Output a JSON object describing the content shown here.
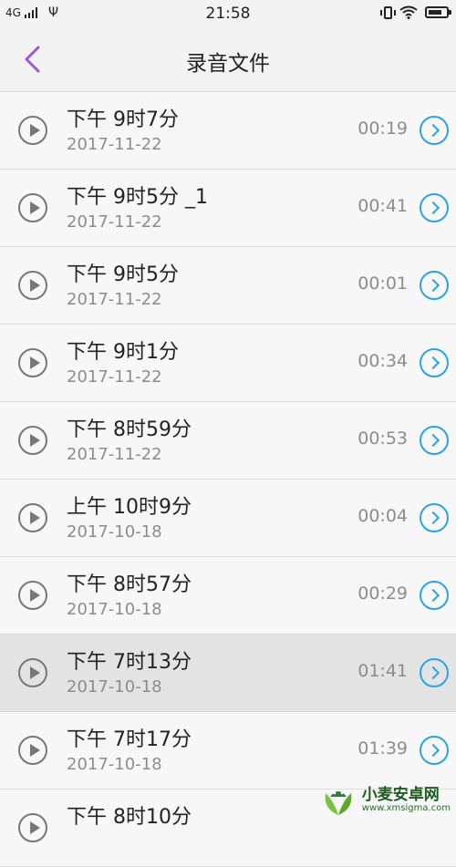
{
  "status_bar": {
    "network": "4G",
    "time": "21:58"
  },
  "header": {
    "title": "录音文件"
  },
  "recordings": [
    {
      "name": "下午 9时7分",
      "date": "2017-11-22",
      "duration": "00:19"
    },
    {
      "name": "下午 9时5分 _1",
      "date": "2017-11-22",
      "duration": "00:41"
    },
    {
      "name": "下午 9时5分",
      "date": "2017-11-22",
      "duration": "00:01"
    },
    {
      "name": "下午 9时1分",
      "date": "2017-11-22",
      "duration": "00:34"
    },
    {
      "name": "下午 8时59分",
      "date": "2017-11-22",
      "duration": "00:53"
    },
    {
      "name": "上午 10时9分",
      "date": "2017-10-18",
      "duration": "00:04"
    },
    {
      "name": "下午 8时57分",
      "date": "2017-10-18",
      "duration": "00:29"
    },
    {
      "name": "下午 7时13分",
      "date": "2017-10-18",
      "duration": "01:41",
      "selected": true
    },
    {
      "name": "下午 7时17分",
      "date": "2017-10-18",
      "duration": "01:39"
    },
    {
      "name": "下午 8时10分",
      "date": "",
      "duration": ""
    }
  ],
  "watermark": {
    "text": "小麦安卓网",
    "url": "www.xmsigma.com"
  },
  "colors": {
    "accent_back": "#9b59d6",
    "detail_blue": "#2aa3e6",
    "selected_row": "#e3e3e3"
  }
}
